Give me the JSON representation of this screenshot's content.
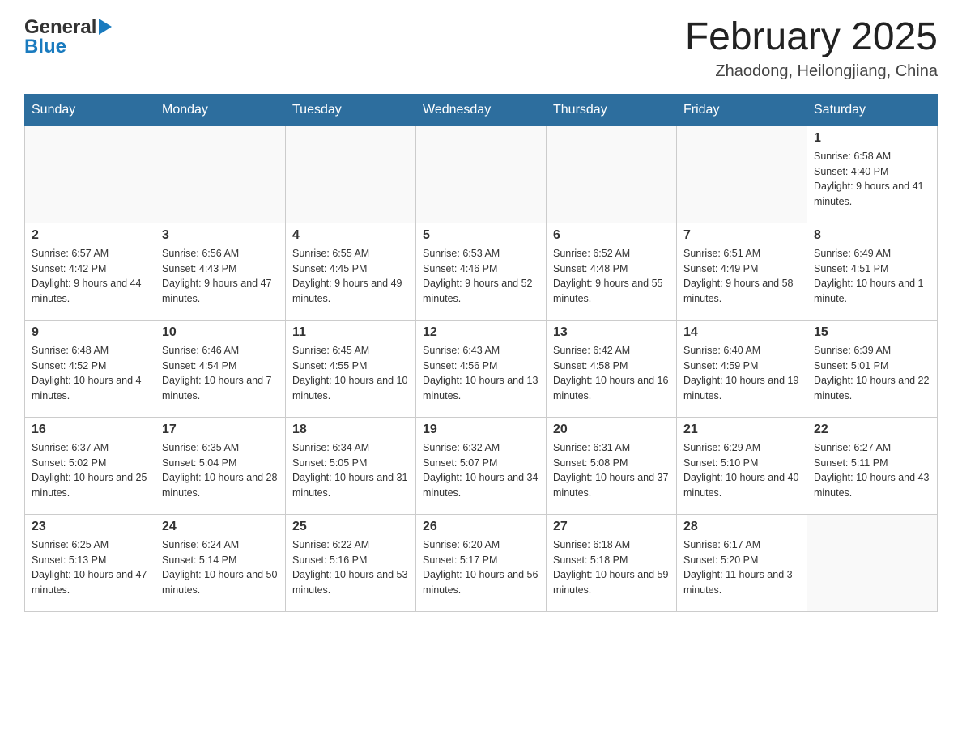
{
  "header": {
    "logo_general": "General",
    "logo_blue": "Blue",
    "month_title": "February 2025",
    "location": "Zhaodong, Heilongjiang, China"
  },
  "weekdays": [
    "Sunday",
    "Monday",
    "Tuesday",
    "Wednesday",
    "Thursday",
    "Friday",
    "Saturday"
  ],
  "weeks": [
    [
      {
        "day": "",
        "info": ""
      },
      {
        "day": "",
        "info": ""
      },
      {
        "day": "",
        "info": ""
      },
      {
        "day": "",
        "info": ""
      },
      {
        "day": "",
        "info": ""
      },
      {
        "day": "",
        "info": ""
      },
      {
        "day": "1",
        "info": "Sunrise: 6:58 AM\nSunset: 4:40 PM\nDaylight: 9 hours and 41 minutes."
      }
    ],
    [
      {
        "day": "2",
        "info": "Sunrise: 6:57 AM\nSunset: 4:42 PM\nDaylight: 9 hours and 44 minutes."
      },
      {
        "day": "3",
        "info": "Sunrise: 6:56 AM\nSunset: 4:43 PM\nDaylight: 9 hours and 47 minutes."
      },
      {
        "day": "4",
        "info": "Sunrise: 6:55 AM\nSunset: 4:45 PM\nDaylight: 9 hours and 49 minutes."
      },
      {
        "day": "5",
        "info": "Sunrise: 6:53 AM\nSunset: 4:46 PM\nDaylight: 9 hours and 52 minutes."
      },
      {
        "day": "6",
        "info": "Sunrise: 6:52 AM\nSunset: 4:48 PM\nDaylight: 9 hours and 55 minutes."
      },
      {
        "day": "7",
        "info": "Sunrise: 6:51 AM\nSunset: 4:49 PM\nDaylight: 9 hours and 58 minutes."
      },
      {
        "day": "8",
        "info": "Sunrise: 6:49 AM\nSunset: 4:51 PM\nDaylight: 10 hours and 1 minute."
      }
    ],
    [
      {
        "day": "9",
        "info": "Sunrise: 6:48 AM\nSunset: 4:52 PM\nDaylight: 10 hours and 4 minutes."
      },
      {
        "day": "10",
        "info": "Sunrise: 6:46 AM\nSunset: 4:54 PM\nDaylight: 10 hours and 7 minutes."
      },
      {
        "day": "11",
        "info": "Sunrise: 6:45 AM\nSunset: 4:55 PM\nDaylight: 10 hours and 10 minutes."
      },
      {
        "day": "12",
        "info": "Sunrise: 6:43 AM\nSunset: 4:56 PM\nDaylight: 10 hours and 13 minutes."
      },
      {
        "day": "13",
        "info": "Sunrise: 6:42 AM\nSunset: 4:58 PM\nDaylight: 10 hours and 16 minutes."
      },
      {
        "day": "14",
        "info": "Sunrise: 6:40 AM\nSunset: 4:59 PM\nDaylight: 10 hours and 19 minutes."
      },
      {
        "day": "15",
        "info": "Sunrise: 6:39 AM\nSunset: 5:01 PM\nDaylight: 10 hours and 22 minutes."
      }
    ],
    [
      {
        "day": "16",
        "info": "Sunrise: 6:37 AM\nSunset: 5:02 PM\nDaylight: 10 hours and 25 minutes."
      },
      {
        "day": "17",
        "info": "Sunrise: 6:35 AM\nSunset: 5:04 PM\nDaylight: 10 hours and 28 minutes."
      },
      {
        "day": "18",
        "info": "Sunrise: 6:34 AM\nSunset: 5:05 PM\nDaylight: 10 hours and 31 minutes."
      },
      {
        "day": "19",
        "info": "Sunrise: 6:32 AM\nSunset: 5:07 PM\nDaylight: 10 hours and 34 minutes."
      },
      {
        "day": "20",
        "info": "Sunrise: 6:31 AM\nSunset: 5:08 PM\nDaylight: 10 hours and 37 minutes."
      },
      {
        "day": "21",
        "info": "Sunrise: 6:29 AM\nSunset: 5:10 PM\nDaylight: 10 hours and 40 minutes."
      },
      {
        "day": "22",
        "info": "Sunrise: 6:27 AM\nSunset: 5:11 PM\nDaylight: 10 hours and 43 minutes."
      }
    ],
    [
      {
        "day": "23",
        "info": "Sunrise: 6:25 AM\nSunset: 5:13 PM\nDaylight: 10 hours and 47 minutes."
      },
      {
        "day": "24",
        "info": "Sunrise: 6:24 AM\nSunset: 5:14 PM\nDaylight: 10 hours and 50 minutes."
      },
      {
        "day": "25",
        "info": "Sunrise: 6:22 AM\nSunset: 5:16 PM\nDaylight: 10 hours and 53 minutes."
      },
      {
        "day": "26",
        "info": "Sunrise: 6:20 AM\nSunset: 5:17 PM\nDaylight: 10 hours and 56 minutes."
      },
      {
        "day": "27",
        "info": "Sunrise: 6:18 AM\nSunset: 5:18 PM\nDaylight: 10 hours and 59 minutes."
      },
      {
        "day": "28",
        "info": "Sunrise: 6:17 AM\nSunset: 5:20 PM\nDaylight: 11 hours and 3 minutes."
      },
      {
        "day": "",
        "info": ""
      }
    ]
  ]
}
